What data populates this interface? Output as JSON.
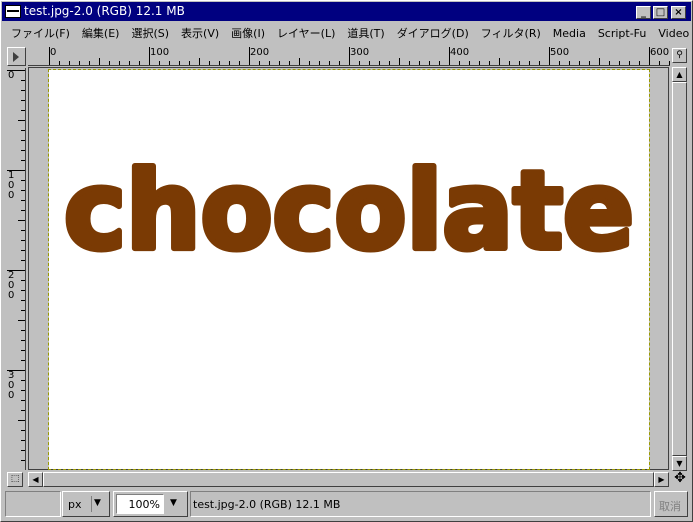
{
  "window": {
    "title": "test.jpg-2.0 (RGB) 12.1 MB",
    "buttons": {
      "minimize": "_",
      "maximize": "□",
      "close": "×"
    }
  },
  "menubar": {
    "items": [
      "ファイル(F)",
      "編集(E)",
      "選択(S)",
      "表示(V)",
      "画像(I)",
      "レイヤー(L)",
      "道具(T)",
      "ダイアログ(D)",
      "フィルタ(R)",
      "Media",
      "Script-Fu",
      "Video"
    ]
  },
  "rulers": {
    "horizontal": [
      "0",
      "100",
      "200",
      "300",
      "400",
      "500",
      "600"
    ],
    "vertical": [
      "0",
      "100",
      "200",
      "300"
    ]
  },
  "canvas": {
    "text": "chocolate",
    "text_color": "#7a3a04",
    "background": "#ffffff"
  },
  "statusbar": {
    "unit": "px",
    "zoom": "100%",
    "message": "test.jpg-2.0 (RGB) 12.1 MB",
    "cancel_label": "取消"
  },
  "icons": {
    "ruler_corner": "triangle-right-icon",
    "zoom_fit": "magnifier-icon",
    "navigate": "move-arrows-icon",
    "quick_mask": "quick-mask-icon"
  }
}
